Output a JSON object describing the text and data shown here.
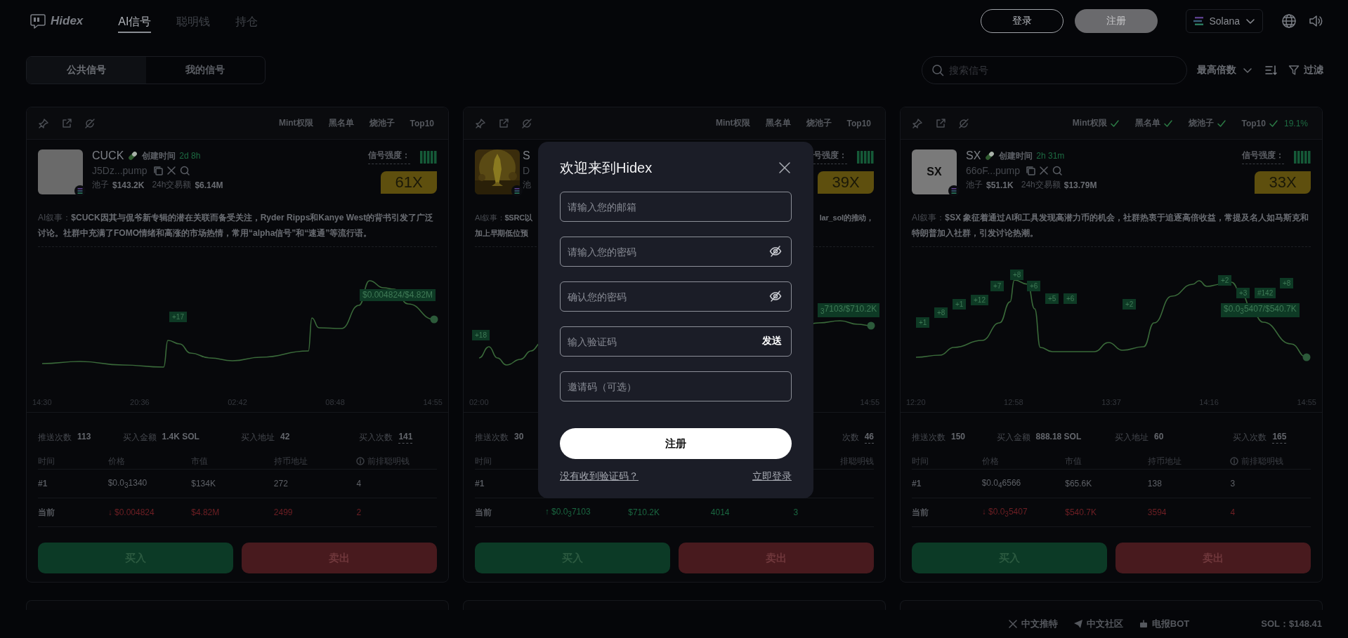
{
  "nav": {
    "brand": "Hidex",
    "tabs": [
      {
        "label": "AI信号",
        "selected": true
      },
      {
        "label": "聪明钱",
        "selected": false
      },
      {
        "label": "持仓",
        "selected": false
      }
    ],
    "login": "登录",
    "register": "注册",
    "chain": "Solana"
  },
  "filters": {
    "segments": [
      {
        "label": "公共信号",
        "selected": true
      },
      {
        "label": "我的信号",
        "selected": false
      }
    ],
    "search": {
      "placeholder": "搜索信号"
    },
    "sort": "最高倍数",
    "filter": "过滤"
  },
  "cards": [
    {
      "kind": "full",
      "flags": [
        {
          "label": "Mint权限",
          "checked": false
        },
        {
          "label": "黑名单",
          "checked": false
        },
        {
          "label": "烧池子",
          "checked": false
        },
        {
          "label": "Top10",
          "checked": false
        }
      ],
      "avatar": {
        "kind": "blank"
      },
      "name": "CUCK",
      "created_label": "创建时间",
      "created": "2d 8h",
      "address": "J5Dz...pump",
      "pool_label": "池子",
      "pool": "$143.2K",
      "volume_label": "24h交易额",
      "volume": "$6.14M",
      "strength_label": "信号强度：",
      "strength": {
        "level": 1
      },
      "multiplier": "61X",
      "narrative": "AI叙事：**$CUCK因其与侃爷新专辑的潜在关联而备受关注，Ryder Ripps和Kanye West的背书引发了广泛讨论。社群中充满了FOMO情绪和高涨的市场热情，常用“alpha信号”和“速通”等流行语。**",
      "chart": {
        "tags": [
          {
            "text": "+17",
            "kind": "count"
          },
          {
            "text": "$0.004824/$4.82M",
            "kind": "price"
          }
        ],
        "times": [
          "14:30",
          "20:36",
          "02:42",
          "08:48",
          "14:55"
        ]
      },
      "stats": [
        {
          "label": "推送次数",
          "value": "113",
          "underline": false
        },
        {
          "label": "买入金额",
          "value": "1.4K SOL",
          "underline": false
        },
        {
          "label": "买入地址",
          "value": "42",
          "underline": false
        },
        {
          "label": "买入次数",
          "value": "141",
          "underline": true
        }
      ],
      "columns": [
        {
          "label": "时间",
          "info": false
        },
        {
          "label": "价格",
          "info": false
        },
        {
          "label": "市值",
          "info": false
        },
        {
          "label": "持币地址",
          "info": false
        },
        {
          "label": "前排聪明钱",
          "info": true
        }
      ],
      "rows": [
        {
          "rising": false,
          "falling": false,
          "cells": [
            "#1",
            "$0.0$_{3}$1340",
            "$134K",
            "272",
            "4"
          ]
        },
        {
          "rising": false,
          "falling": true,
          "cells": [
            "当前",
            "↓ $0.004824",
            "$4.82M",
            "2499",
            "2"
          ]
        }
      ],
      "buy": "买入",
      "sell": "卖出"
    },
    {
      "kind": "partial",
      "flags": [
        {
          "label": "Mint权限",
          "checked": false
        },
        {
          "label": "黑名单",
          "checked": false
        },
        {
          "label": "烧池子",
          "checked": false
        },
        {
          "label": "Top10",
          "checked": false
        }
      ],
      "avatar": {
        "kind": "picture"
      },
      "name": "S",
      "address": "D",
      "pool_label": "池",
      "strength_label": "号强度：",
      "strength": {
        "level": 1
      },
      "multiplier": "39X",
      "narrative_lines": [
        {
          "left": "AI叙事：**$SRC以**",
          "right": "**lar_sol的推动，**"
        },
        {
          "left": "**加上早期低位预**"
        }
      ],
      "chart": {
        "tags": [
          {
            "text": "+18",
            "kind": "count"
          },
          {
            "text": "$_{3}$7103/$710.2K",
            "kind": "price"
          }
        ],
        "times": [
          "02:00",
          "14:55"
        ]
      },
      "stats": [
        {
          "label": "推送次数",
          "value": "30",
          "underline": false
        },
        {
          "label": "次数",
          "value": "46",
          "underline": true
        }
      ],
      "columns": [
        {
          "label": "时间",
          "info": false
        },
        {
          "label": "排聪明钱",
          "info": false
        }
      ],
      "rows": [
        {
          "cells": [
            "#1"
          ]
        },
        {
          "rising": true,
          "falling": false,
          "cells": [
            "当前",
            "↑ $0.0$_{3}$7103",
            "$710.2K",
            "4014",
            "3"
          ]
        }
      ],
      "buy": "买入",
      "sell": "卖出"
    },
    {
      "kind": "full",
      "flags": [
        {
          "label": "Mint权限",
          "checked": true
        },
        {
          "label": "黑名单",
          "checked": true
        },
        {
          "label": "烧池子",
          "checked": true
        },
        {
          "label": "Top10",
          "checked": true
        }
      ],
      "top10_share": "19.1%",
      "avatar": {
        "kind": "text",
        "text": "SX"
      },
      "name": "SX",
      "created_label": "创建时间",
      "created": "2h 31m",
      "address": "66oF...pump",
      "pool_label": "池子",
      "pool": "$51.1K",
      "volume_label": "24h交易额",
      "volume": "$13.79M",
      "strength_label": "信号强度：",
      "strength": {
        "level": 1
      },
      "multiplier": "33X",
      "narrative": "AI叙事：**$SX 象征着通过AI和工具发现高潜力币的机会，社群热衷于追逐高倍收益，常提及名人如马斯克和特朗普加入社群，引发讨论热潮。**",
      "chart": {
        "tags": [
          {
            "text": "+1",
            "kind": "count"
          },
          {
            "text": "+8",
            "kind": "count"
          },
          {
            "text": "+1",
            "kind": "count"
          },
          {
            "text": "+12",
            "kind": "count"
          },
          {
            "text": "+7",
            "kind": "count"
          },
          {
            "text": "+8",
            "kind": "count"
          },
          {
            "text": "+6",
            "kind": "count"
          },
          {
            "text": "+5",
            "kind": "count"
          },
          {
            "text": "+6",
            "kind": "count"
          },
          {
            "text": "+2",
            "kind": "count"
          },
          {
            "text": "+2",
            "kind": "count"
          },
          {
            "text": "+3",
            "kind": "count"
          },
          {
            "text": "#142",
            "kind": "count"
          },
          {
            "text": "+8",
            "kind": "count"
          },
          {
            "text": "$0.0$_{3}$5407/$540.7K",
            "kind": "price"
          }
        ],
        "times": [
          "12:20",
          "12:58",
          "13:37",
          "14:16",
          "14:55"
        ]
      },
      "stats": [
        {
          "label": "推送次数",
          "value": "150",
          "underline": false
        },
        {
          "label": "买入金额",
          "value": "888.18 SOL",
          "underline": false
        },
        {
          "label": "买入地址",
          "value": "60",
          "underline": false
        },
        {
          "label": "买入次数",
          "value": "165",
          "underline": true
        }
      ],
      "columns": [
        {
          "label": "时间",
          "info": false
        },
        {
          "label": "价格",
          "info": false
        },
        {
          "label": "市值",
          "info": false
        },
        {
          "label": "持币地址",
          "info": false
        },
        {
          "label": "前排聪明钱",
          "info": true
        }
      ],
      "rows": [
        {
          "rising": false,
          "falling": false,
          "cells": [
            "#1",
            "$0.0$_{4}$6566",
            "$65.6K",
            "138",
            "3"
          ]
        },
        {
          "rising": false,
          "falling": true,
          "cells": [
            "当前",
            "↓ $0.0$_{3}$5407",
            "$540.7K",
            "3594",
            "4"
          ]
        }
      ],
      "buy": "买入",
      "sell": "卖出"
    }
  ],
  "modal": {
    "title": "欢迎来到Hidex",
    "fields": [
      {
        "kind": "plain",
        "placeholder": "请输入您的邮箱"
      },
      {
        "kind": "password",
        "placeholder": "请输入您的密码"
      },
      {
        "kind": "password",
        "placeholder": "确认您的密码"
      },
      {
        "kind": "code",
        "placeholder": "输入验证码",
        "action": "发送"
      },
      {
        "kind": "plain",
        "placeholder": "邀请码（可选）"
      }
    ],
    "submit": "注册",
    "resend": "没有收到验证码？",
    "login": "立即登录"
  },
  "footer": {
    "links": [
      {
        "kind": "x",
        "label": "中文推特"
      },
      {
        "kind": "telegram",
        "label": "中文社区"
      },
      {
        "kind": "bot",
        "label": "电报BOT"
      }
    ],
    "price": "SOL：$148.41"
  }
}
